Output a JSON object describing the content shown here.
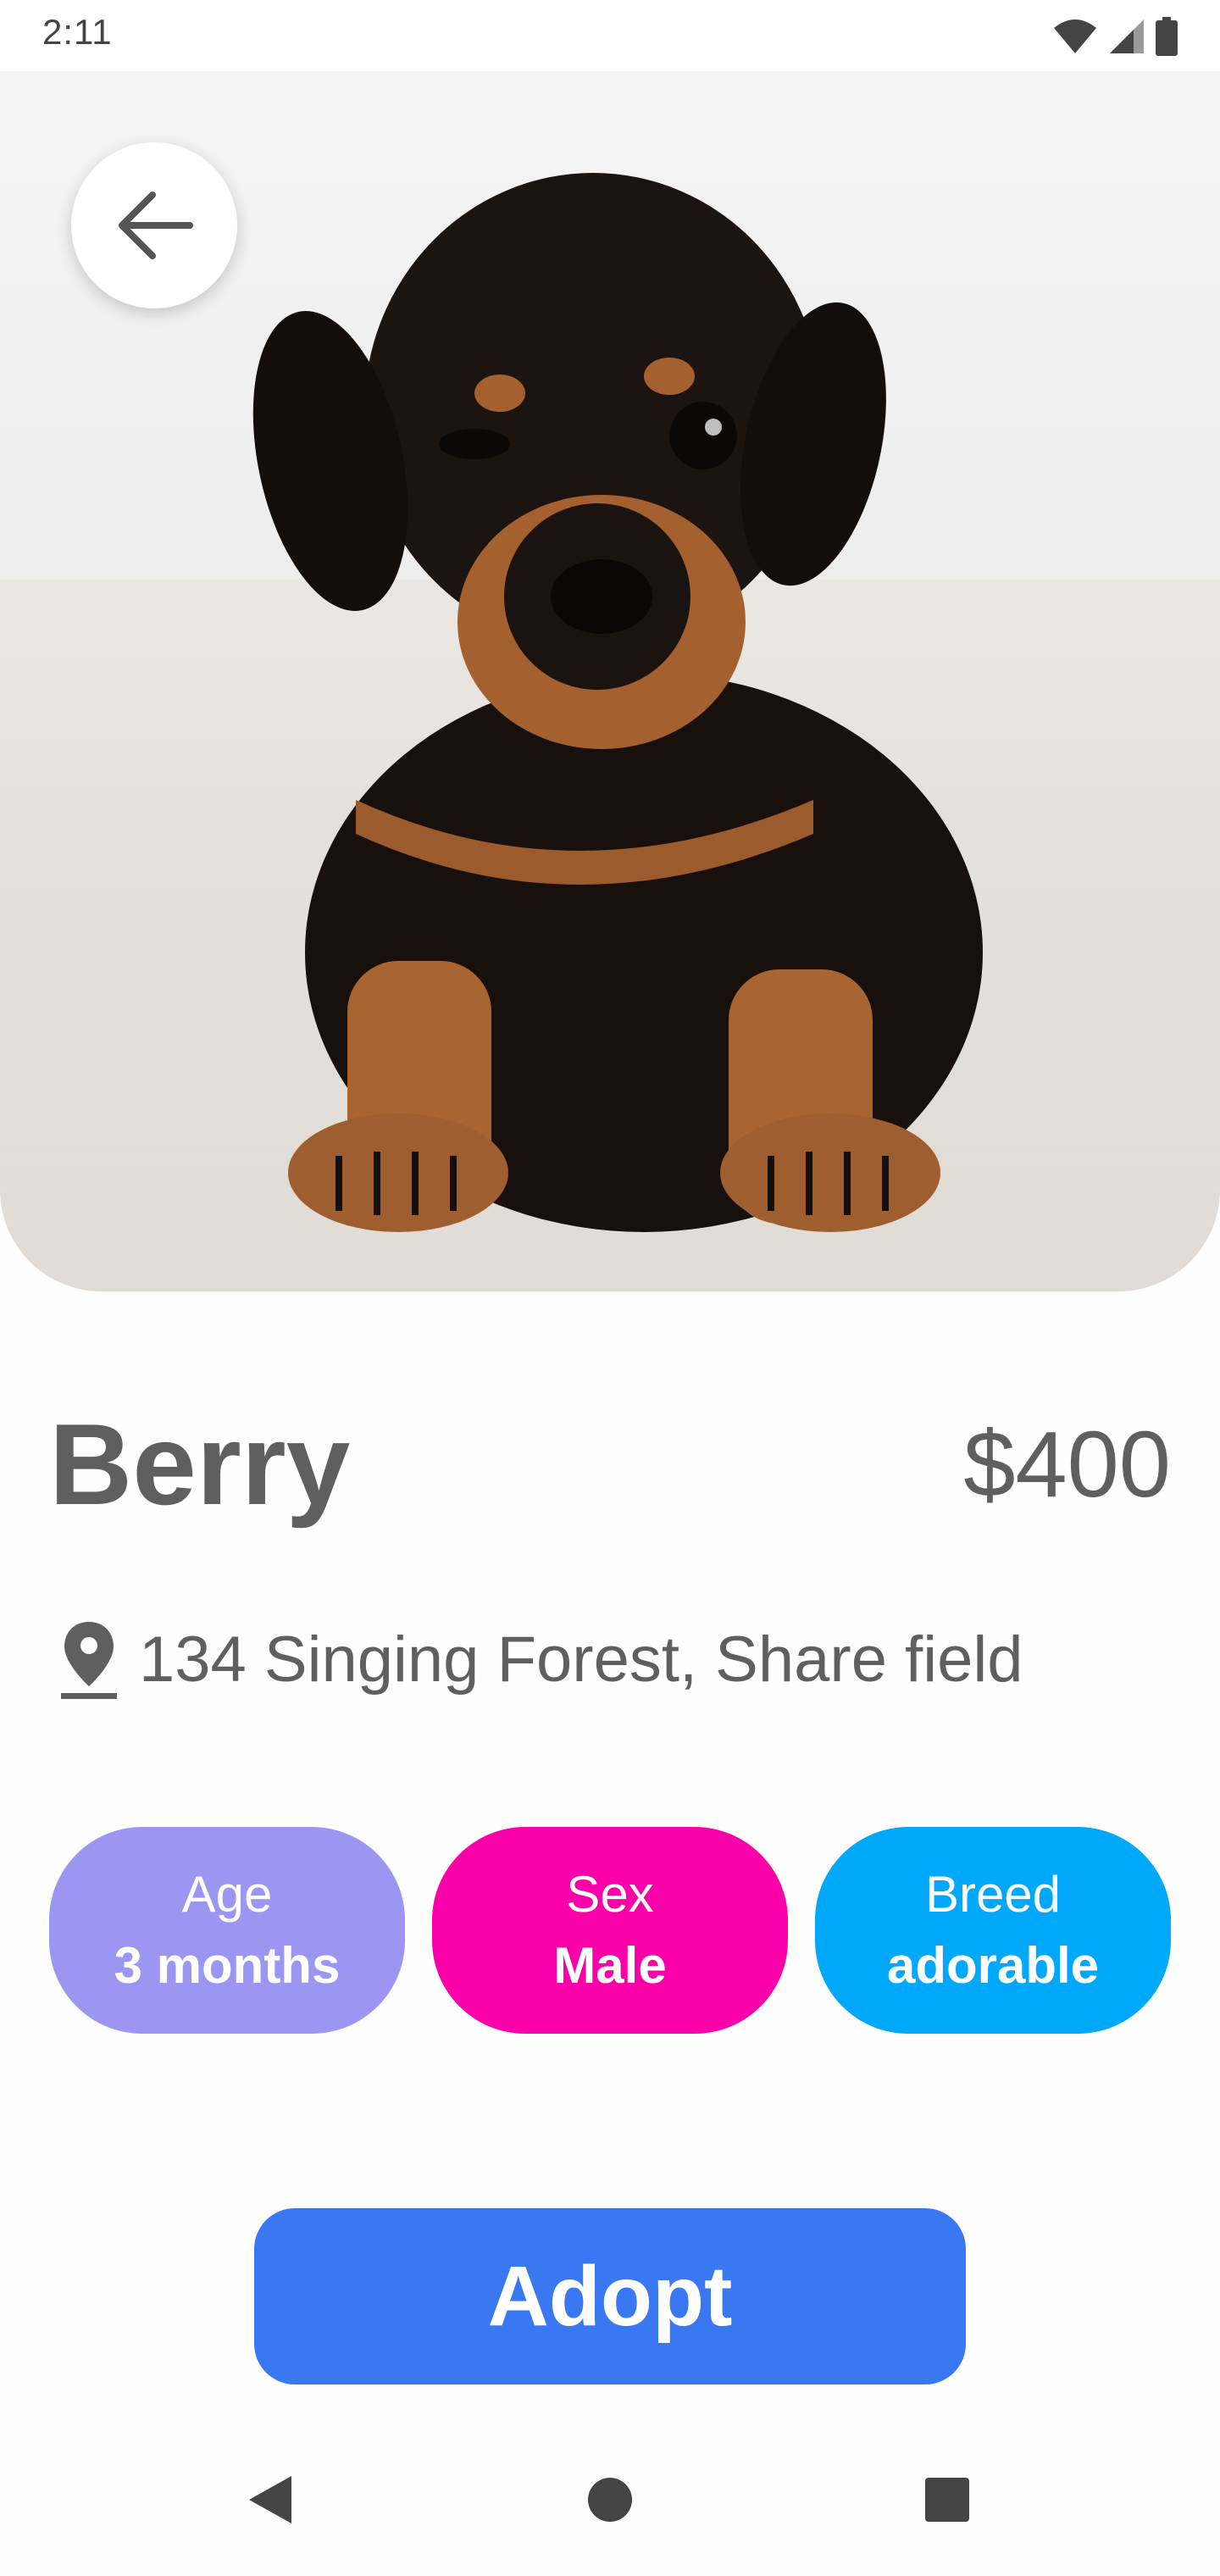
{
  "status_bar": {
    "time": "2:11",
    "icons": [
      "wifi-icon",
      "signal-icon",
      "battery-icon"
    ]
  },
  "hero": {
    "image": "puppy-photo",
    "back_icon": "arrow-left-icon"
  },
  "pet": {
    "name": "Berry",
    "price": "$400",
    "location": "134 Singing Forest, Share field",
    "location_icon": "location-pin-icon"
  },
  "chips": [
    {
      "label": "Age",
      "value": "3 months",
      "color": "#9b96f2"
    },
    {
      "label": "Sex",
      "value": "Male",
      "color": "#fb00a8"
    },
    {
      "label": "Breed",
      "value": "adorable",
      "color": "#00a8f9"
    }
  ],
  "actions": {
    "adopt_label": "Adopt",
    "adopt_color": "#3a78f2"
  },
  "nav": {
    "icons": [
      "back-triangle-icon",
      "home-circle-icon",
      "recents-square-icon"
    ]
  }
}
